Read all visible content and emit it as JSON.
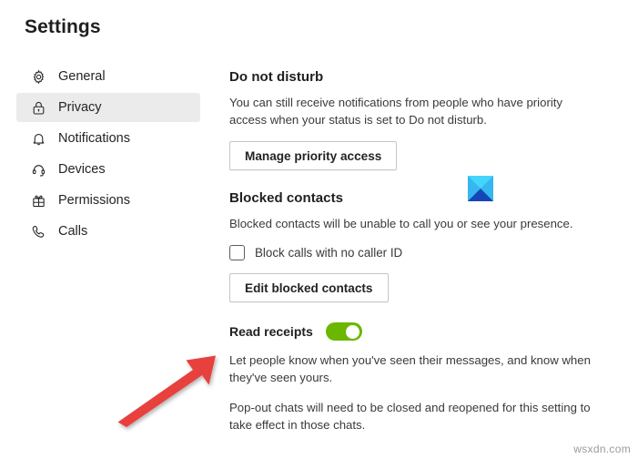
{
  "page": {
    "title": "Settings",
    "watermark": "wsxdn.com"
  },
  "sidebar": {
    "items": [
      {
        "label": "General",
        "icon": "gear-icon",
        "active": false
      },
      {
        "label": "Privacy",
        "icon": "lock-icon",
        "active": true
      },
      {
        "label": "Notifications",
        "icon": "bell-icon",
        "active": false
      },
      {
        "label": "Devices",
        "icon": "headset-icon",
        "active": false
      },
      {
        "label": "Permissions",
        "icon": "permissions-icon",
        "active": false
      },
      {
        "label": "Calls",
        "icon": "phone-icon",
        "active": false
      }
    ]
  },
  "main": {
    "do_not_disturb": {
      "heading": "Do not disturb",
      "description": "You can still receive notifications from people who have priority access when your status is set to Do not disturb.",
      "button_label": "Manage priority access"
    },
    "blocked_contacts": {
      "heading": "Blocked contacts",
      "description": "Blocked contacts will be unable to call you or see your presence.",
      "checkbox_label": "Block calls with no caller ID",
      "checkbox_checked": "false",
      "button_label": "Edit blocked contacts"
    },
    "read_receipts": {
      "label": "Read receipts",
      "toggle_state": "on",
      "description_1": "Let people know when you've seen their messages, and know when they've seen yours.",
      "description_2": "Pop-out chats will need to be closed and reopened for this setting to take effect in those chats."
    }
  },
  "annotations": {
    "arrow": {
      "name": "red-arrow-pointing-to-read-receipts",
      "color": "#e8413c"
    },
    "blue_square": {
      "name": "blue-x-square-icon",
      "color_light": "#29c5f6",
      "color_dark": "#1447b5"
    }
  },
  "colors": {
    "accent_green": "#6bb700",
    "sidebar_active_bg": "#ebebeb",
    "text_primary": "#252423",
    "text_secondary": "#3b3a39",
    "border": "#c8c6c4"
  }
}
